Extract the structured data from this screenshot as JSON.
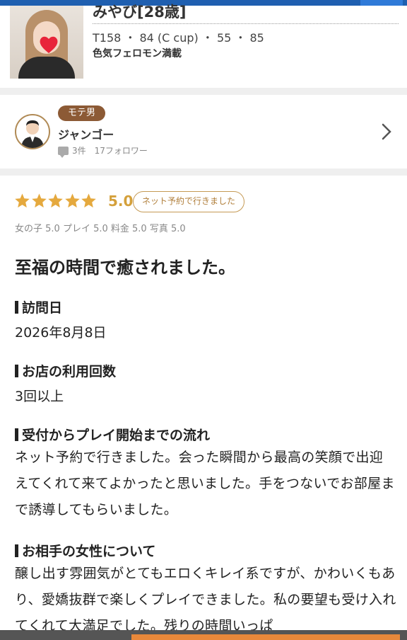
{
  "girl": {
    "name": "みやび[28歳]",
    "stats": "T158 ・ 84 (C cup) ・ 55 ・ 85",
    "tagline": "色気フェロモン満載"
  },
  "user": {
    "badge": "モテ男",
    "name": "ジャンゴー",
    "reviews_count": "3件",
    "followers": "17フォロワー"
  },
  "review": {
    "rating": 5,
    "score": "5.0",
    "reservation_badge": "ネット予約で行きました",
    "subscores": "女の子 5.0 プレイ 5.0 料金 5.0 写真 5.0",
    "title": "至福の時間で癒されました。",
    "sections": [
      {
        "heading": "訪問日",
        "value": "2026年8月8日"
      },
      {
        "heading": "お店の利用回数",
        "value": "3回以上"
      },
      {
        "heading": "受付からプレイ開始までの流れ",
        "value": "ネット予約で行きました。会った瞬間から最高の笑顔で出迎えてくれて来てよかったと思いました。手をつないでお部屋まで誘導してもらいました。"
      },
      {
        "heading": "お相手の女性について",
        "value": "醸し出す雰囲気がとてもエロくキレイ系ですが、かわいくもあり、愛嬌抜群で楽しくプレイできました。私の要望も受け入れてくれて大満足でした。残りの時間いっぱ"
      }
    ]
  },
  "colors": {
    "accent_gold": "#d4a03b",
    "star": "#e5a93e",
    "badge_brown": "#8c5a35"
  }
}
